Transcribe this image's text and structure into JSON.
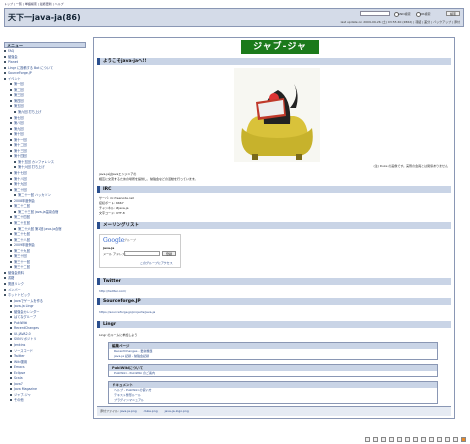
{
  "topnav": "トップ | 一覧 | 単語検索 | 最終更新 | ヘルプ",
  "header": {
    "title": "天下一java-ja(86)",
    "search_button": "検索",
    "opt_and": "AND検索",
    "opt_or": "OR検索",
    "last_update": "last update on 2009-09-26 (土) 03:55:40 (286d) | 凍結 | 差分 | バックアップ | 添付"
  },
  "sidebar": {
    "heading": "メニュー",
    "items": [
      {
        "label": "FAQ",
        "level": 1
      },
      {
        "label": "勉強会",
        "level": 1
      },
      {
        "label": "Planet",
        "level": 1
      },
      {
        "label": "Lingr に投稿する Bot について",
        "level": 1
      },
      {
        "label": "SourceForge.JP",
        "level": 1
      },
      {
        "label": "イベント",
        "level": 1
      },
      {
        "label": "第一回",
        "level": 2
      },
      {
        "label": "第二回",
        "level": 2
      },
      {
        "label": "第三回",
        "level": 2
      },
      {
        "label": "第四回",
        "level": 2
      },
      {
        "label": "第五回",
        "level": 2
      },
      {
        "label": "第六回 打ち上げ",
        "level": 3
      },
      {
        "label": "第七回",
        "level": 2
      },
      {
        "label": "第八回",
        "level": 2
      },
      {
        "label": "第九回",
        "level": 2
      },
      {
        "label": "第十回",
        "level": 2
      },
      {
        "label": "第十一回",
        "level": 2
      },
      {
        "label": "第十二回",
        "level": 2
      },
      {
        "label": "第十三回",
        "level": 2
      },
      {
        "label": "第十四回",
        "level": 2
      },
      {
        "label": "第十五回 カンファレンス",
        "level": 3
      },
      {
        "label": "第十六回 打ち上げ",
        "level": 3
      },
      {
        "label": "第十七回",
        "level": 2
      },
      {
        "label": "第十八回",
        "level": 2
      },
      {
        "label": "第十九回",
        "level": 2
      },
      {
        "label": "第二十回",
        "level": 2
      },
      {
        "label": "第二十一回 ハッカソン",
        "level": 3
      },
      {
        "label": "2008年度例会",
        "level": 2
      },
      {
        "label": "第二十二回",
        "level": 2
      },
      {
        "label": "第二十三回 java-ja温泉合宿",
        "level": 3
      },
      {
        "label": "第二十四回",
        "level": 2
      },
      {
        "label": "第二十五回",
        "level": 2
      },
      {
        "label": "第二十六回 第1回 java-ja合宿",
        "level": 3
      },
      {
        "label": "第二十七回",
        "level": 2
      },
      {
        "label": "第二十八回",
        "level": 2
      },
      {
        "label": "2009年度例会",
        "level": 2
      },
      {
        "label": "第二十九回",
        "level": 2
      },
      {
        "label": "第三十回",
        "level": 2
      },
      {
        "label": "第三十一回",
        "level": 2
      },
      {
        "label": "第三十二回",
        "level": 2
      },
      {
        "label": "勉強会資料",
        "level": 1
      },
      {
        "label": "書籍",
        "level": 1
      },
      {
        "label": "関連リンク",
        "level": 1
      },
      {
        "label": "メンバー",
        "level": 1
      },
      {
        "label": "ホットトピック",
        "level": 1
      },
      {
        "label": "Javaでゲームを作る",
        "level": 2
      },
      {
        "label": "java-ja Lingr",
        "level": 2
      },
      {
        "label": "勉強会カレンダー",
        "level": 2
      },
      {
        "label": "はてなグループ",
        "level": 2
      },
      {
        "label": "PukiWiki",
        "level": 2
      },
      {
        "label": "RecentChanges",
        "level": 2
      },
      {
        "label": "UI-JAVA2.0",
        "level": 2
      },
      {
        "label": "SVNリポジトリ",
        "level": 2
      },
      {
        "label": "Jenkins",
        "level": 2
      },
      {
        "label": "ソースコード",
        "level": 2
      },
      {
        "label": "Twitter",
        "level": 2
      },
      {
        "label": "Wiki運用",
        "level": 2
      },
      {
        "label": "Emacs",
        "level": 2
      },
      {
        "label": "Eclipse",
        "level": 2
      },
      {
        "label": "Scala",
        "level": 2
      },
      {
        "label": "Java7",
        "level": 2
      },
      {
        "label": "Java Magazine",
        "level": 2
      },
      {
        "label": "ジャブ-ジャ",
        "level": 2
      },
      {
        "label": "その他",
        "level": 2
      }
    ]
  },
  "main": {
    "logo_text": "ジャブ-ジャ",
    "welcome_heading": "ようこそjava-jaへ!!",
    "photo_caption": "(注) Duke の画像です。実際の会員とは関係ありません",
    "intro_line1": "java-jaはJavaエンジニアの",
    "intro_line2": "相互に交流するための場所を提供し、勉強会などの活動を行っています。",
    "irc_heading": "IRC",
    "irc_lines": [
      "サーバ: irc.freenode.net",
      "接続ポート: 6667",
      "チャンネル: #java-ja",
      "文字コード: UTF-8"
    ],
    "ml_heading": "メーリングリスト",
    "google_logo": "Google",
    "google_sub": "グループ",
    "group_name": "java-ja",
    "mail_label": "メール アドレス:",
    "join_button": "登録",
    "visit_link": "このグループにアクセス",
    "twitter_heading": "Twitter",
    "twitter_url": "http://twitter.com/",
    "sf_heading": "Sourceforge.JP",
    "sf_url": "https://sourceforge.jp/projects/java-ja",
    "lingr_heading": "Lingr",
    "lingr_text": "Lingr のルームに参加しよう",
    "sub1_heading": "編集ページ",
    "sub1_rows": [
      "RecentChanges - 更新履歴",
      "java-ja 記録 - 勉強会記録"
    ],
    "sub2_heading": "PukiWikiについて",
    "sub2_rows": [
      "PukiWiki - PukiWiki のご案内"
    ],
    "sub3_heading": "ドキュメント",
    "sub3_rows": [
      "ヘルプ - PukiWiki の使い方",
      "テキスト整形ルール",
      "プラグインマニュアル"
    ],
    "footer_label": "添付ファイル:",
    "footer_files": [
      "java-ja.png",
      "duke.png",
      "java-ja-logo.png"
    ]
  }
}
